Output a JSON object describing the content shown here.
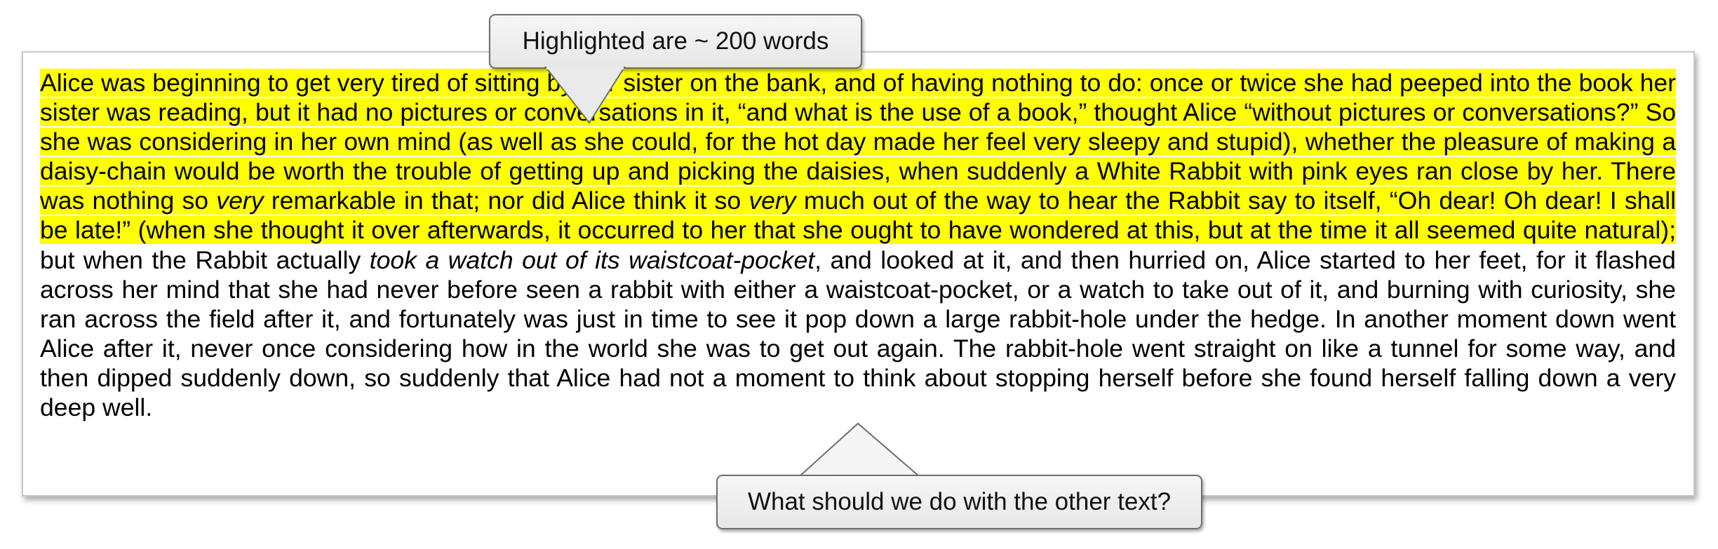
{
  "callouts": {
    "top_label": "Highlighted are ~ 200 words",
    "bottom_label": "What should we do with the other text?"
  },
  "passage": {
    "highlighted": {
      "part1": "Alice was beginning to get very tired of sitting by her sister on the bank, and of having nothing to do: once or twice she had peeped into the book her sister was reading, but it had no pictures or conversations in it, “and what is the use of a book,” thought Alice “without pictures or conversations?” So she was considering in her own mind (as well as she could, for the hot day made her feel very sleepy and stupid), whether the pleasure of making a daisy-chain would be worth the trouble of getting up and picking the daisies, when suddenly a White Rabbit with pink eyes ran close by her. There was nothing so ",
      "emph1": "very",
      "part2": " remarkable in that; nor did Alice think it so ",
      "emph2": "very",
      "part3": " much out of the way to hear the Rabbit say to itself, “Oh dear! Oh dear! I shall be late!” (when she thought it over afterwards, it occurred to her that she ought to have wondered at this, but at the time it all seemed quite natural);"
    },
    "plain": {
      "part1": " but when the Rabbit actually ",
      "emph": "took a watch out of its waistcoat-pocket",
      "part2": ", and looked at it, and then hurried on, Alice started to her feet, for it flashed across her mind that she had never before seen a rabbit with either a waistcoat-pocket, or a watch to take out of it, and burning with curiosity, she ran across the field after it, and fortunately was just in time to see it pop down a large rabbit-hole under the hedge. In another moment down went Alice after it, never once considering how in the world she was to get out again. The rabbit-hole went straight on like a tunnel for some way, and then dipped suddenly down, so suddenly that Alice had not a moment to think about stopping herself before she found herself falling down a very deep well."
    }
  },
  "colors": {
    "highlight": "#ffff00",
    "callout_fill": "#efefef",
    "callout_border": "#6e6e6e"
  }
}
